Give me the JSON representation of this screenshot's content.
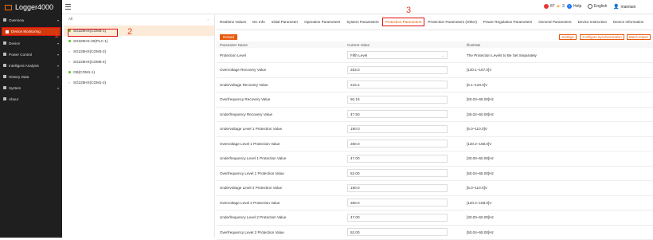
{
  "app": {
    "title": "Logger4000"
  },
  "topbar": {
    "alerts_red": "87",
    "alerts_yellow": "3",
    "help": "Help",
    "language": "English",
    "user": "maintain"
  },
  "sidebar": {
    "items": [
      {
        "label": "Overview",
        "icon": "grid-icon",
        "chevron": "▾"
      },
      {
        "label": "Device Monitoring",
        "icon": "monitor-icon",
        "active": true
      },
      {
        "label": "Device",
        "icon": "wrench-icon",
        "chevron": "▾"
      },
      {
        "label": "Power Control",
        "icon": "power-icon",
        "chevron": "▾"
      },
      {
        "label": "Intelligent Analysis",
        "icon": "chart-icon",
        "chevron": "▾"
      },
      {
        "label": "History Data",
        "icon": "clock-icon",
        "chevron": "▾"
      },
      {
        "label": "System",
        "icon": "gear-icon",
        "chevron": "▾"
      },
      {
        "label": "About",
        "icon": "info-icon"
      }
    ]
  },
  "annotations": {
    "a1": "1",
    "a2": "2",
    "a3": "3"
  },
  "devices": {
    "filter": "All",
    "items": [
      {
        "label": "SG320HX(COM3-1)",
        "status": "online",
        "selected": true
      },
      {
        "label": "SG320HX-20(PLC-1)",
        "status": "online"
      },
      {
        "label": "SG225HX(COM3-2)",
        "status": "offline"
      },
      {
        "label": "SG225HX(COM5-4)",
        "status": "offline"
      },
      {
        "label": "GB(COM1-1)",
        "status": "online"
      },
      {
        "label": "SG225HX(COM1-2)",
        "status": "offline"
      }
    ]
  },
  "tabs": [
    "Realtime Values",
    "DC Info",
    "Initial Parameter",
    "Operation Parameters",
    "System Parameters",
    "Protection Parameters",
    "Protection Parameters (Other)",
    "Power Regulation Parameters",
    "General Parameters",
    "Device Instruction",
    "Device Information"
  ],
  "toolbar": {
    "reload": "Reload",
    "settings": "Settings",
    "configure": "Configure Synchronization",
    "batch": "Batch Import"
  },
  "table": {
    "headers": [
      "Parameter Name",
      "Current Value",
      "Illustrate"
    ],
    "rows": [
      {
        "name": "Protection Level",
        "value": "Fifth Level",
        "range": "The Protection Levels to Be Set Separately",
        "dropdown": true
      },
      {
        "name": "Overvoltage Recovery Value",
        "value": "253.0",
        "range": "[120.1~167.0]V"
      },
      {
        "name": "Undervoltage Recovery Value",
        "value": "216.2",
        "range": "[6.1~120.0]V"
      },
      {
        "name": "Overfrequency Recovery Value",
        "value": "50.15",
        "range": "[50.03~55.00]Hz"
      },
      {
        "name": "Underfrequency Recovery Value",
        "value": "47.50",
        "range": "[35.02~50.00]Hz"
      },
      {
        "name": "Undervoltage Level 1 Protection Value",
        "value": "190.0",
        "range": "[6.0~110.0]V"
      },
      {
        "name": "Overvoltage Level 1 Protection Value",
        "value": "280.0",
        "range": "[120.2~168.0]V"
      },
      {
        "name": "Underfrequency Level 1 Protection Value",
        "value": "47.00",
        "range": "[30.00~50.00]Hz"
      },
      {
        "name": "Overfrequency Level 1 Protection Value",
        "value": "52.00",
        "range": "[50.04~55.00]Hz"
      },
      {
        "name": "Undervoltage Level 2 Protection Value",
        "value": "190.0",
        "range": "[6.0~110.0]V"
      },
      {
        "name": "Overvoltage Level 2 Protection Value",
        "value": "280.0",
        "range": "[120.2~168.0]V"
      },
      {
        "name": "Underfrequency Level 2 Protection Value",
        "value": "47.00",
        "range": "[30.00~50.00]Hz"
      },
      {
        "name": "Overfrequency Level 2 Protection Value",
        "value": "52.00",
        "range": "[50.04~55.00]Hz"
      }
    ]
  }
}
